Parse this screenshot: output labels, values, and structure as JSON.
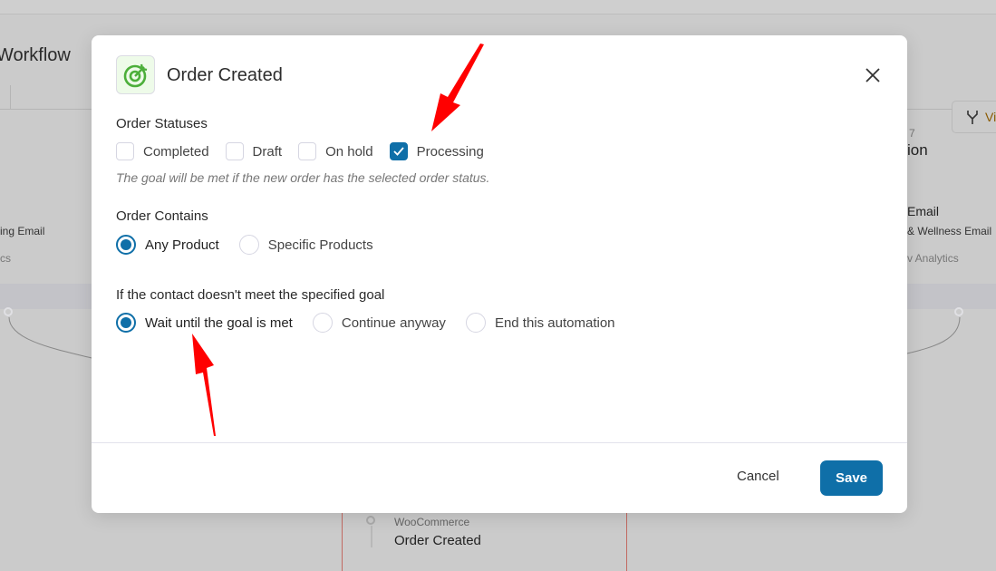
{
  "background": {
    "workflow_title": "Workflow",
    "left_card_email": "ing Email",
    "left_card_analytics": "cs",
    "right_card_step": "7",
    "right_card_title": "ion",
    "right_card_type": "Email",
    "right_card_email": "& Wellness Email",
    "right_card_analytics": "v Analytics",
    "view_button": "Vi",
    "bottom_card_provider": "WooCommerce",
    "bottom_card_title": "Order Created"
  },
  "modal": {
    "title": "Order Created",
    "icon": "goal-target-icon",
    "order_statuses": {
      "label": "Order Statuses",
      "options": [
        {
          "label": "Completed",
          "checked": false
        },
        {
          "label": "Draft",
          "checked": false
        },
        {
          "label": "On hold",
          "checked": false
        },
        {
          "label": "Processing",
          "checked": true
        }
      ],
      "help": "The goal will be met if the new order has the selected order status."
    },
    "order_contains": {
      "label": "Order Contains",
      "options": [
        {
          "label": "Any Product",
          "selected": true
        },
        {
          "label": "Specific Products",
          "selected": false
        }
      ]
    },
    "not_met": {
      "label": "If the contact doesn't meet the specified goal",
      "options": [
        {
          "label": "Wait until the goal is met",
          "selected": true
        },
        {
          "label": "Continue anyway",
          "selected": false
        },
        {
          "label": "End this automation",
          "selected": false
        }
      ]
    },
    "cancel_label": "Cancel",
    "save_label": "Save"
  },
  "colors": {
    "accent": "#0f6fa8",
    "annotation_arrow": "#ff0000",
    "icon_green": "#4caf3a"
  }
}
